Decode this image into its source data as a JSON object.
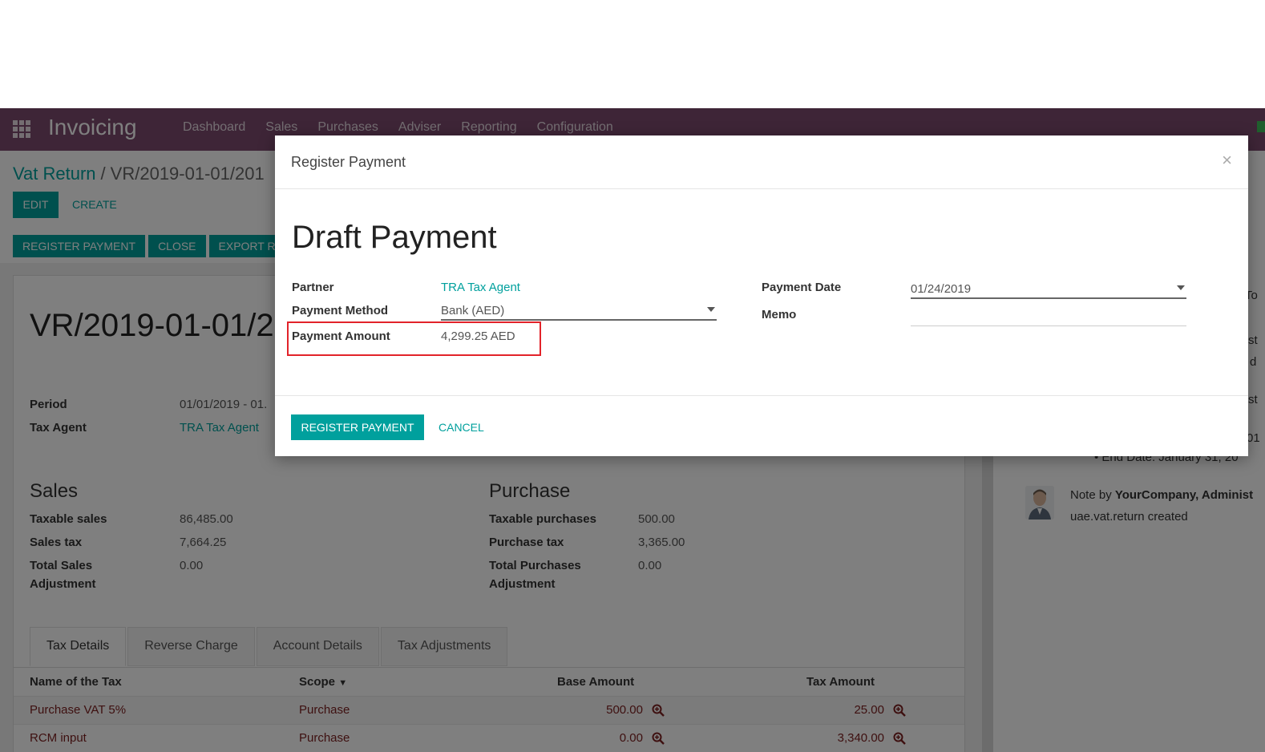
{
  "navbar": {
    "brand": "Invoicing",
    "menu": [
      "Dashboard",
      "Sales",
      "Purchases",
      "Adviser",
      "Reporting",
      "Configuration"
    ]
  },
  "breadcrumb": {
    "parent": "Vat Return",
    "separator": "/",
    "current": "VR/2019-01-01/201"
  },
  "controls": {
    "edit": "EDIT",
    "create": "CREATE"
  },
  "statusbar": {
    "register_payment": "REGISTER PAYMENT",
    "close": "CLOSE",
    "export": "EXPORT R"
  },
  "record": {
    "title": "VR/2019-01-01/2",
    "period_label": "Period",
    "period_value": "01/01/2019 - 01.",
    "tax_agent_label": "Tax Agent",
    "tax_agent_value": "TRA Tax Agent"
  },
  "sales": {
    "title": "Sales",
    "taxable_label": "Taxable sales",
    "taxable_value": "86,485.00",
    "tax_label": "Sales tax",
    "tax_value": "7,664.25",
    "adj_label_1": "Total Sales",
    "adj_label_2": "Adjustment",
    "adj_value": "0.00"
  },
  "purchase": {
    "title": "Purchase",
    "taxable_label": "Taxable purchases",
    "taxable_value": "500.00",
    "tax_label": "Purchase tax",
    "tax_value": "3,365.00",
    "adj_label_1": "Total Purchases",
    "adj_label_2": "Adjustment",
    "adj_value": "0.00"
  },
  "tabs": [
    "Tax Details",
    "Reverse Charge",
    "Account Details",
    "Tax Adjustments"
  ],
  "table": {
    "headers": {
      "name": "Name of the Tax",
      "scope": "Scope",
      "base": "Base Amount",
      "tax": "Tax Amount"
    },
    "rows": [
      {
        "name": "Purchase VAT 5%",
        "scope": "Purchase",
        "base": "500.00",
        "tax": "25.00"
      },
      {
        "name": "RCM input",
        "scope": "Purchase",
        "base": "0.00",
        "tax": "3,340.00"
      }
    ]
  },
  "chatter": {
    "frag_1": "To",
    "frag_2": "st",
    "frag_3": "d",
    "frag_4": "st",
    "frag_5": "01",
    "bullet": "End Date: January 31, 20",
    "note_prefix": "Note by ",
    "note_author": "YourCompany, Administ",
    "note_body": "uae.vat.return created"
  },
  "modal": {
    "header_title": "Register Payment",
    "close": "×",
    "title": "Draft Payment",
    "partner_label": "Partner",
    "partner_value": "TRA Tax Agent",
    "method_label": "Payment Method",
    "method_value": "Bank (AED)",
    "amount_label": "Payment Amount",
    "amount_value": "4,299.25 AED",
    "date_label": "Payment Date",
    "date_value": "01/24/2019",
    "memo_label": "Memo",
    "memo_value": "",
    "register_button": "REGISTER PAYMENT",
    "cancel_button": "CANCEL"
  },
  "colors": {
    "navbar": "#7c4a6e",
    "primary": "#00a09d",
    "highlight": "#e2232a",
    "link_red": "#7c2020"
  }
}
